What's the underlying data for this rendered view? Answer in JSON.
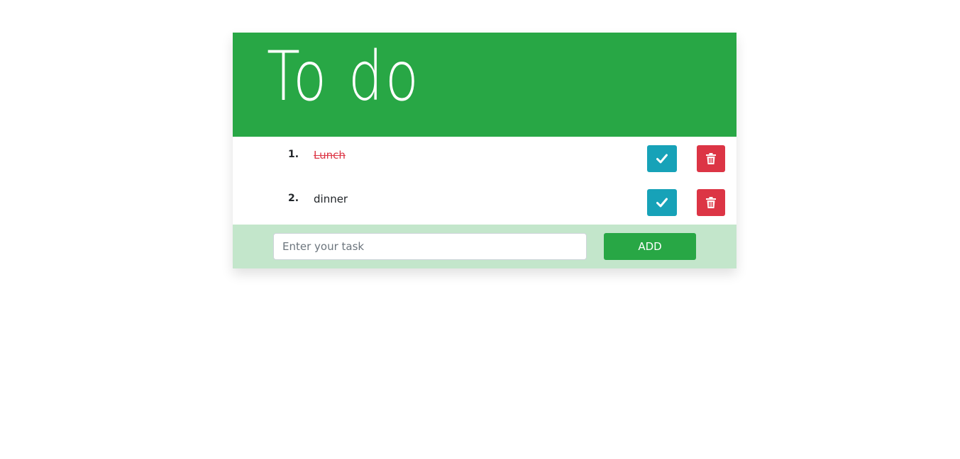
{
  "header": {
    "title": "To do"
  },
  "tasks": [
    {
      "number": "1.",
      "text": "Lunch",
      "done": true
    },
    {
      "number": "2.",
      "text": "dinner",
      "done": false
    }
  ],
  "icons": {
    "complete": "check-icon",
    "delete": "trash-icon"
  },
  "input": {
    "placeholder": "Enter your task",
    "value": ""
  },
  "add_button": {
    "label": "ADD"
  },
  "colors": {
    "header": "#28a745",
    "footer": "#c3e6cb",
    "complete_button": "#17a2b8",
    "delete_button": "#dc3545",
    "done_text": "#dc3545"
  }
}
